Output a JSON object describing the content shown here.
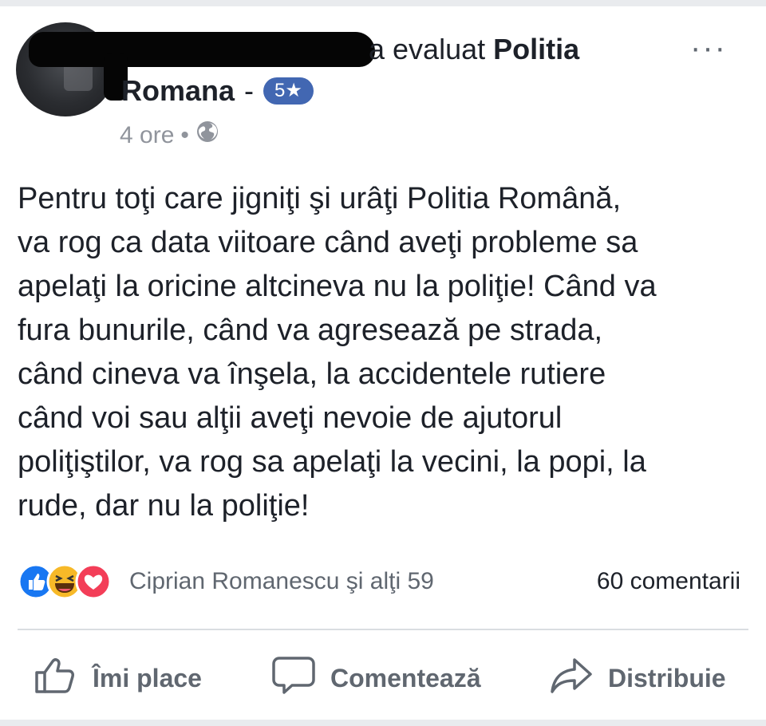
{
  "header": {
    "reviewer_suffix": "a evaluat",
    "page_name_part1": "Politia",
    "page_name_part2": "Romana",
    "separator": "-",
    "rating": "5★",
    "time": "4 ore",
    "dot": "•",
    "more": "···"
  },
  "post": {
    "lines": [
      "Pentru toţi care jigniţi şi urâţi Politia Română,",
      "va rog ca data viitoare când aveţi probleme sa",
      "apelaţi la oricine altcineva nu la poliţie! Când va",
      "fura bunurile, când va agresează pe strada,",
      "când cineva va înşela, la accidentele rutiere",
      "când voi sau alţii aveţi nevoie de ajutorul",
      "poliţiştilor, va rog sa apelaţi la vecini, la popi, la",
      "rude, dar nu la poliţie!"
    ]
  },
  "reactions": {
    "icons": [
      "like-reaction-icon",
      "haha-reaction-icon",
      "love-reaction-icon"
    ],
    "summary": "Ciprian Romanescu şi alţi 59",
    "comments": "60 comentarii"
  },
  "actions": {
    "like_label": "Îmi place",
    "comment_label": "Comentează",
    "share_label": "Distribuie"
  },
  "colors": {
    "accent": "#4267b2",
    "text": "#1d2129",
    "muted": "#606770",
    "like": "#1877f2",
    "haha": "#f7b928",
    "love": "#f33e58"
  }
}
